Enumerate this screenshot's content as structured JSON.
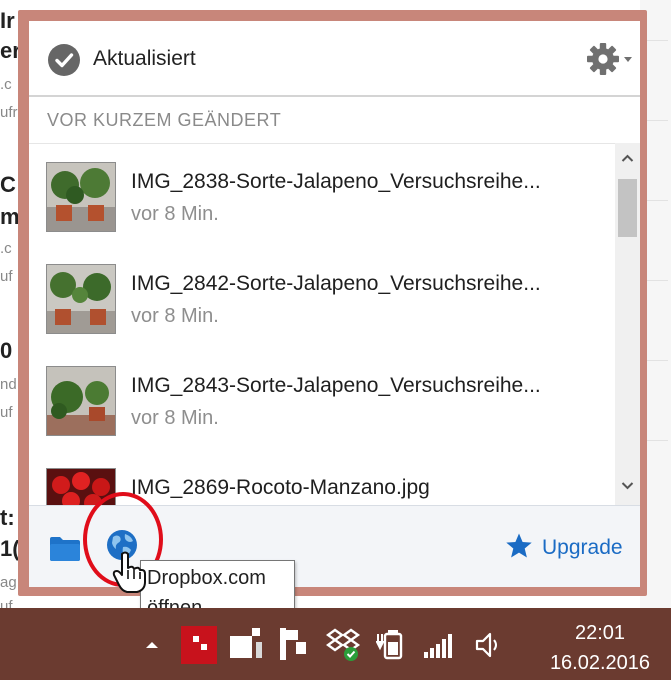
{
  "background": {
    "fragments": [
      "Ir",
      "er",
      ".c",
      "ufr",
      "C",
      "m",
      ".c",
      "uf",
      "0",
      "nd",
      "uf",
      "t:",
      "1(",
      "ag",
      "uf"
    ]
  },
  "dropbox": {
    "status": "Aktualisiert",
    "section_title": "VOR KURZEM GEÄNDERT",
    "files": [
      {
        "name": "IMG_2838-Sorte-Jalapeno_Versuchsreihe...",
        "time": "vor 8 Min."
      },
      {
        "name": "IMG_2842-Sorte-Jalapeno_Versuchsreihe...",
        "time": "vor 8 Min."
      },
      {
        "name": "IMG_2843-Sorte-Jalapeno_Versuchsreihe...",
        "time": "vor 8 Min."
      },
      {
        "name": "IMG_2869-Rocoto-Manzano.jpg",
        "time": ""
      }
    ],
    "upgrade_label": "Upgrade",
    "tooltip": [
      "Dropbox.com",
      "öffnen"
    ]
  },
  "taskbar": {
    "time": "22:01",
    "date": "16.02.2016"
  },
  "colors": {
    "popup_border": "#c8867a",
    "accent_blue": "#1a6bc4",
    "annotation_red": "#e00d1a",
    "taskbar": "#6b3b30"
  },
  "icons": [
    "check-circle-icon",
    "gear-icon",
    "scroll-up-icon",
    "scroll-down-icon",
    "folder-icon",
    "globe-icon",
    "star-icon",
    "hand-cursor-icon",
    "tray-arrow-icon",
    "dropbox-icon",
    "battery-icon",
    "signal-icon",
    "speaker-icon"
  ]
}
